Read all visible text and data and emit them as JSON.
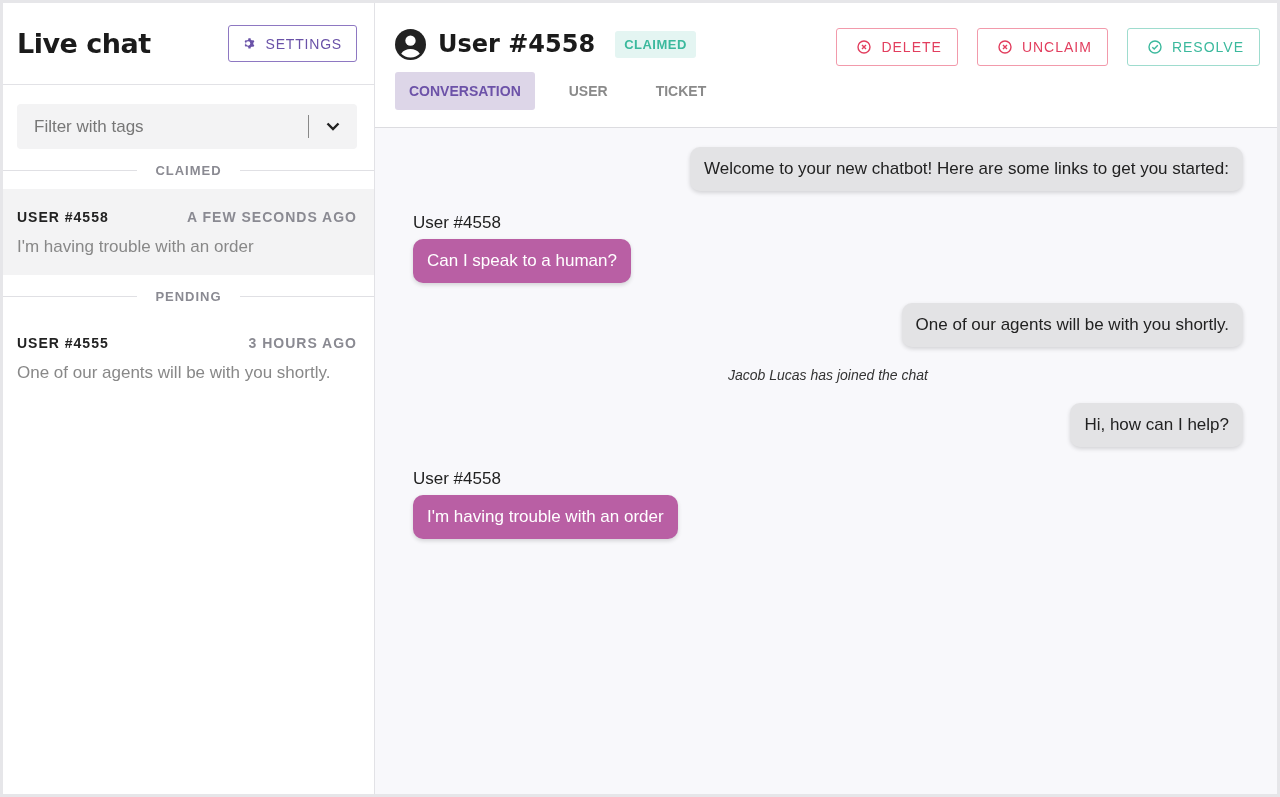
{
  "sidebar": {
    "title": "Live chat",
    "settings_button": "SETTINGS",
    "filter": {
      "placeholder": "Filter with tags"
    },
    "groups": [
      {
        "label": "CLAIMED",
        "conversations": [
          {
            "user": "USER #4558",
            "time": "A FEW SECONDS AGO",
            "preview": "I'm having trouble with an order",
            "selected": true
          }
        ]
      },
      {
        "label": "PENDING",
        "conversations": [
          {
            "user": "USER #4555",
            "time": "3 HOURS AGO",
            "preview": "One of our agents will be with you shortly.",
            "selected": false
          }
        ]
      }
    ]
  },
  "header": {
    "user": "User #4558",
    "status": "CLAIMED",
    "actions": [
      {
        "label": "DELETE",
        "kind": "danger"
      },
      {
        "label": "UNCLAIM",
        "kind": "danger"
      },
      {
        "label": "RESOLVE",
        "kind": "success"
      }
    ],
    "tabs": [
      {
        "label": "CONVERSATION",
        "selected": true
      },
      {
        "label": "USER",
        "selected": false
      },
      {
        "label": "TICKET",
        "selected": false
      }
    ]
  },
  "messages": [
    {
      "kind": "bot",
      "text": "Welcome to your new chatbot! Here are some links to get you started:"
    },
    {
      "kind": "user",
      "author": "User #4558",
      "text": "Can I speak to a human?"
    },
    {
      "kind": "bot",
      "text": "One of our agents will be with you shortly."
    },
    {
      "kind": "event",
      "text": "Jacob Lucas has joined the chat"
    },
    {
      "kind": "bot",
      "text": "Hi, how can I help?"
    },
    {
      "kind": "user",
      "author": "User #4558",
      "text": "I'm having trouble with an order"
    }
  ]
}
